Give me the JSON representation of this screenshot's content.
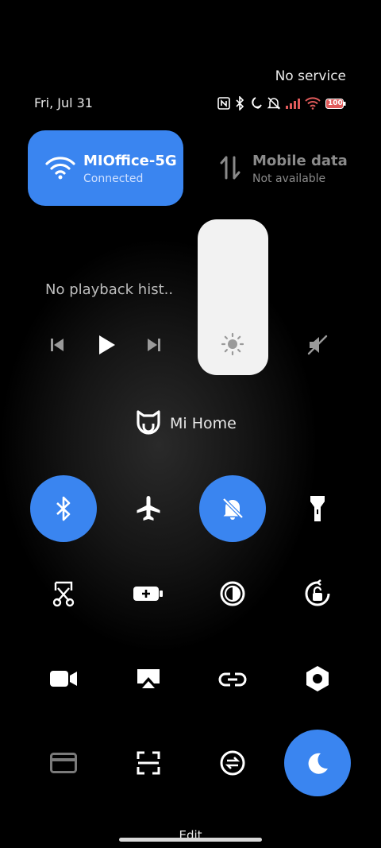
{
  "status": {
    "carrier": "No service",
    "date": "Fri, Jul 31",
    "icons": [
      "nfc-icon",
      "bluetooth-icon",
      "moon-icon",
      "bell-off-icon",
      "signal-icon",
      "wifi-icon",
      "battery-icon"
    ],
    "battery_level": "100"
  },
  "wifi": {
    "name": "MIOffice-5G",
    "status": "Connected"
  },
  "mobile": {
    "name": "Mobile data",
    "status": "Not available"
  },
  "media": {
    "title": "No playback hist..."
  },
  "mihome": {
    "label": "Mi Home"
  },
  "footer": {
    "edit_label": "Edit"
  },
  "colors": {
    "accent": "#3a85f0",
    "background": "#000000"
  }
}
